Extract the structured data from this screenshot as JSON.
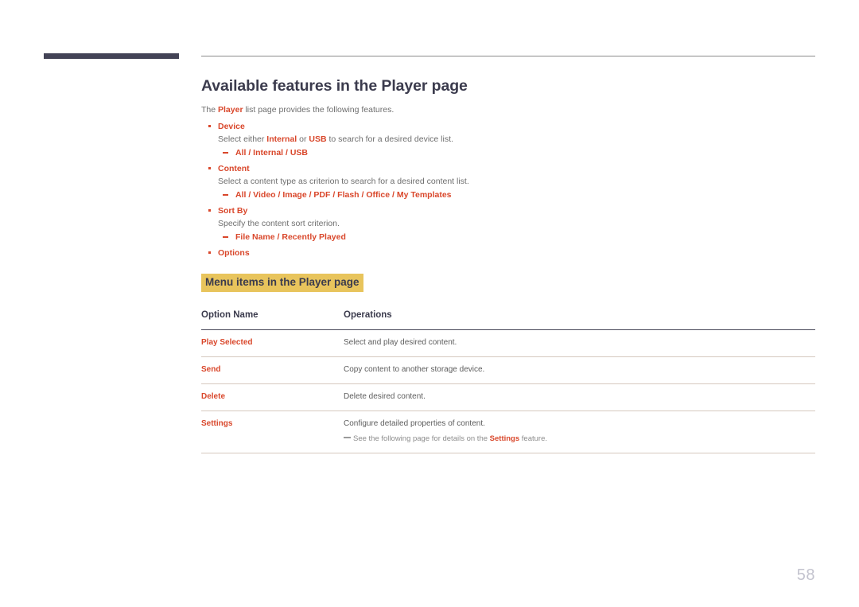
{
  "page": {
    "number": "58"
  },
  "heading": {
    "title": "Available features in the Player page",
    "intro_before": "The ",
    "intro_accent": "Player",
    "intro_after": " list page provides the following features."
  },
  "features": [
    {
      "title": "Device",
      "desc": "Select either ",
      "desc_accent1": "Internal",
      "desc_mid": " or ",
      "desc_accent2": "USB",
      "desc_end": " to search for a desired device list.",
      "options": "All / Internal / USB"
    },
    {
      "title": "Content",
      "desc": "Select a content type as criterion to search for a desired content list.",
      "options": "All / Video / Image / PDF / Flash / Office / My Templates"
    },
    {
      "title": "Sort By",
      "desc": "Specify the content sort criterion.",
      "options": "File Name / Recently Played"
    },
    {
      "title": "Options"
    }
  ],
  "section": {
    "heading": "Menu items in the Player page"
  },
  "table": {
    "columns": [
      "Option Name",
      "Operations"
    ],
    "rows": [
      {
        "name": "Play Selected",
        "desc": "Select and play desired content."
      },
      {
        "name": "Send",
        "desc": "Copy content to another storage device."
      },
      {
        "name": "Delete",
        "desc": "Delete desired content."
      },
      {
        "name": "Settings",
        "desc": "Configure detailed properties of content.",
        "note_before": "See the following page for details on the ",
        "note_accent": "Settings",
        "note_after": " feature."
      }
    ]
  },
  "colors": {
    "accent": "#d9472b",
    "highlight": "#e8c45c",
    "heading": "#3b3b4d",
    "body_text": "#6e6e6e",
    "corner_bar": "#434356"
  }
}
